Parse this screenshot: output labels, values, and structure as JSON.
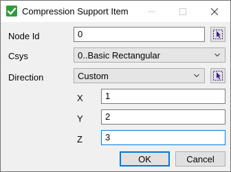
{
  "window": {
    "title": "Compression Support Item",
    "icon": "checkmark-icon",
    "controls": [
      "minimize-icon",
      "maximize-icon",
      "close-icon"
    ]
  },
  "form": {
    "node_id": {
      "label": "Node Id",
      "value": "0"
    },
    "csys": {
      "label": "Csys",
      "value": "0..Basic Rectangular"
    },
    "direction": {
      "label": "Direction",
      "value": "Custom"
    },
    "x": {
      "label": "X",
      "value": "1"
    },
    "y": {
      "label": "Y",
      "value": "2"
    },
    "z": {
      "label": "Z",
      "value": "3"
    }
  },
  "buttons": {
    "ok": "OK",
    "cancel": "Cancel"
  },
  "colors": {
    "accent": "#0078d7",
    "icon_green": "#2e9c3c",
    "pick_purple": "#3a1a8c"
  }
}
